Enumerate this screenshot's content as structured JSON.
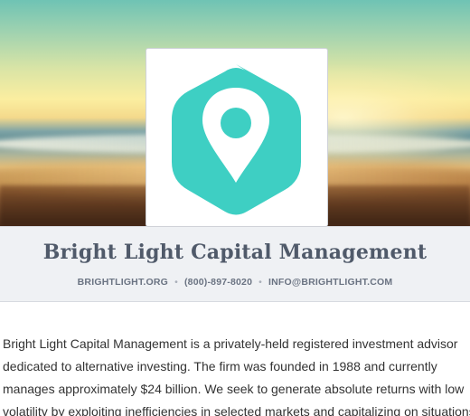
{
  "header": {
    "company_name": "Bright Light Capital Management",
    "contact": {
      "website": "BRIGHTLIGHT.ORG",
      "phone": "(800)-897-8020",
      "email": "INFO@BRIGHTLIGHT.COM",
      "separator": "•"
    }
  },
  "logo": {
    "icon": "map-pin-hexagon-icon",
    "color": "#3ecfc3"
  },
  "about": {
    "text": "Bright Light Capital Management is a privately-held registered investment advisor dedicated to alternative investing. The firm was founded in 1988 and currently manages approximately $24 billion. We seek to generate absolute returns with low volatility by exploiting inefficiencies in selected markets and capitalizing on situations"
  }
}
